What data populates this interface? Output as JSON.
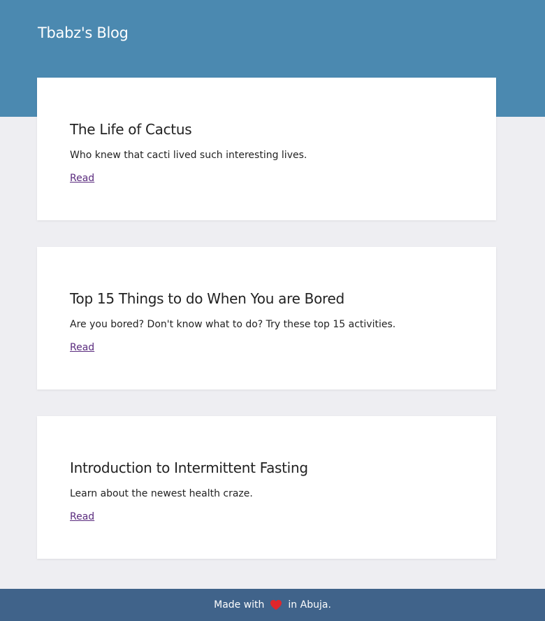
{
  "header": {
    "title": "Tbabz's Blog"
  },
  "posts": [
    {
      "title": "The Life of Cactus",
      "excerpt": "Who knew that cacti lived such interesting lives.",
      "link_label": "Read"
    },
    {
      "title": "Top 15 Things to do When You are Bored",
      "excerpt": "Are you bored? Don't know what to do? Try these top 15 activities.",
      "link_label": "Read"
    },
    {
      "title": "Introduction to Intermittent Fasting",
      "excerpt": "Learn about the newest health craze.",
      "link_label": "Read"
    }
  ],
  "footer": {
    "text_before": "Made with",
    "icon": "heart-icon",
    "text_after": "in Abuja."
  },
  "colors": {
    "header_bg": "#4b89b0",
    "page_bg": "#eeeef2",
    "footer_bg": "#40638a",
    "link": "#5a2b7e",
    "heart": "#e0262b"
  }
}
